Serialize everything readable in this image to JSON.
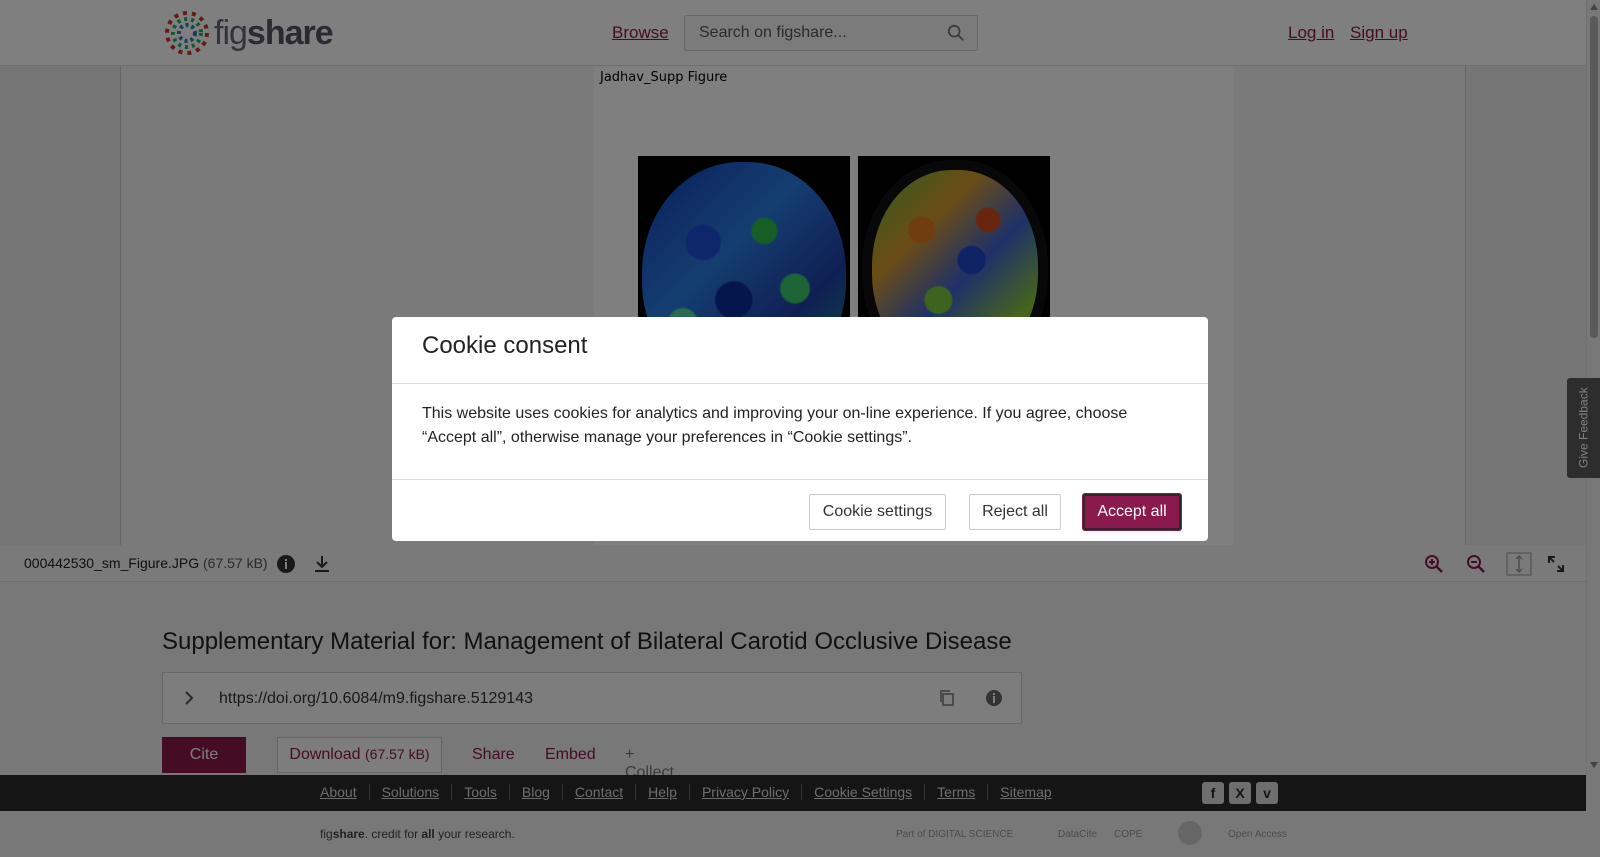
{
  "header": {
    "logo_text_fig": "fig",
    "logo_text_share": "share",
    "browse": "Browse",
    "search_placeholder": "Search on figshare...",
    "login": "Log in",
    "signup": "Sign up"
  },
  "viewer": {
    "figure_label": "Jadhav_Supp Figure",
    "file_name": "000442530_sm_Figure.JPG",
    "file_size": "(67.57 kB)"
  },
  "article": {
    "title": "Supplementary Material for: Management of Bilateral Carotid Occlusive Disease",
    "doi": "https://doi.org/10.6084/m9.figshare.5129143",
    "cite": "Cite",
    "download": "Download",
    "download_size": "(67.57 kB)",
    "share": "Share",
    "embed": "Embed",
    "collect": "+ Collect"
  },
  "footer": {
    "links": [
      "About",
      "Solutions",
      "Tools",
      "Blog",
      "Contact",
      "Help",
      "Privacy Policy",
      "Cookie Settings",
      "Terms",
      "Sitemap"
    ],
    "credit_fig": "fig",
    "credit_share": "share",
    "credit_mid": ". credit for ",
    "credit_all": "all",
    "credit_end": " your research.",
    "partner_digital": "Part of DIGITAL SCIENCE",
    "partner_datacite": "DataCite",
    "partner_cope": "COPE",
    "partner_open": "Open Access"
  },
  "feedback": "Give Feedback",
  "cookie_modal": {
    "title": "Cookie consent",
    "body": "This website uses cookies for analytics and improving your on-line experience. If you agree, choose “Accept all”, otherwise manage your preferences in “Cookie settings”.",
    "settings": "Cookie settings",
    "reject": "Reject all",
    "accept": "Accept all"
  },
  "colors": {
    "brand": "#8a1a4b",
    "footer_bg": "#2a2a2a"
  }
}
